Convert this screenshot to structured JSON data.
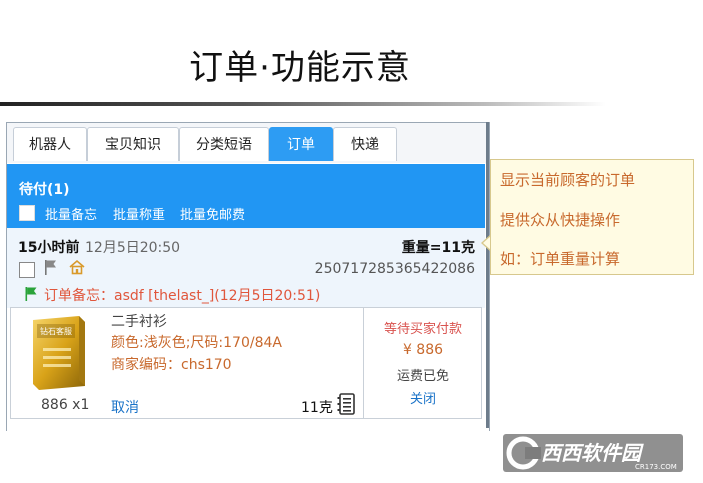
{
  "slide": {
    "title": "订单·功能示意"
  },
  "tabs": [
    {
      "label": "机器人",
      "active": false
    },
    {
      "label": "宝贝知识",
      "active": false
    },
    {
      "label": "分类短语",
      "active": false
    },
    {
      "label": "订单",
      "active": true
    },
    {
      "label": "快递",
      "active": false
    }
  ],
  "pending_bar": {
    "title": "待付(1)",
    "batch_actions": [
      "批量备忘",
      "批量称重",
      "批量免邮费"
    ]
  },
  "order": {
    "time_ago": "15小时前",
    "date": "12月5日20:50",
    "weight": "重量=11克",
    "order_number": "250717285365422086",
    "memo": "订单备忘：asdf [thelast_](12月5日20:51)"
  },
  "item": {
    "image_text": "钻石客服",
    "name": "二手衬衫",
    "attributes": "颜色:浅灰色;尺码:170/84A",
    "merchant_code": "商家编码：chs170",
    "quantity": "886 x1",
    "cancel_label": "取消",
    "weight": "11克",
    "status": "等待买家付款",
    "price": "¥ 886",
    "shipping": "运费已免",
    "close_label": "关闭"
  },
  "callout": {
    "lines": [
      "显示当前顾客的订单",
      "提供众从快捷操作",
      "如：订单重量计算"
    ]
  },
  "watermark": {
    "text": "西西软件园",
    "sub": "CR173.COM"
  },
  "colors": {
    "accent_blue": "#2196f3",
    "memo_red": "#e0563c",
    "attr_orange": "#c8692d",
    "link_blue": "#1a73c8",
    "callout_bg": "#fffbe3"
  }
}
